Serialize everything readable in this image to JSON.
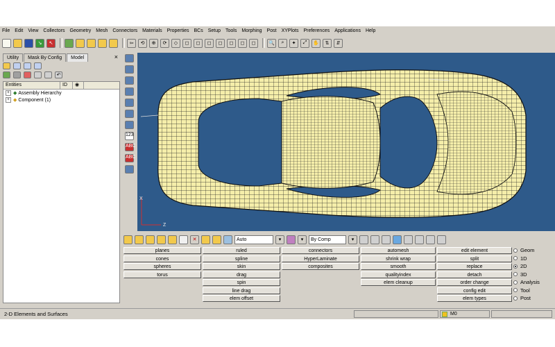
{
  "menu": [
    "File",
    "Edit",
    "View",
    "Collectors",
    "Geometry",
    "Mesh",
    "Connectors",
    "Materials",
    "Properties",
    "BCs",
    "Setup",
    "Tools",
    "Morphing",
    "Post",
    "XYPlots",
    "Preferences",
    "Applications",
    "Help"
  ],
  "panel": {
    "tabs": [
      "Utility",
      "Mask By Config",
      "Model"
    ],
    "active_tab": "Model",
    "columns": [
      "Entities",
      "ID"
    ],
    "tree": [
      {
        "label": "Assembly Hierarchy"
      },
      {
        "label": "Component (1)"
      }
    ]
  },
  "viewport": {
    "background": "#2e5a8a",
    "mesh_color": "#f5eeaa",
    "axes": {
      "x": "X",
      "z": "Z"
    }
  },
  "bottom_toolbar": {
    "dropdown_auto": "Auto",
    "dropdown_bycomp": "By Comp"
  },
  "buttons": {
    "col1": [
      "planes",
      "cones",
      "spheres",
      "torus"
    ],
    "col2": [
      "ruled",
      "spline",
      "skin",
      "drag",
      "spin",
      "line drag",
      "elem offset"
    ],
    "col3": [
      "connectors",
      "HyperLaminate",
      "composites"
    ],
    "col4": [
      "automesh",
      "shrink wrap",
      "smooth",
      "qualityindex",
      "elem cleanup"
    ],
    "col5": [
      "edit element",
      "split",
      "replace",
      "detach",
      "order change",
      "config edit",
      "elem types"
    ]
  },
  "radios": {
    "options": [
      "Geom",
      "1D",
      "2D",
      "3D",
      "Analysis",
      "Tool",
      "Post"
    ],
    "selected": "2D"
  },
  "status": {
    "text": "2-D Elements and Surfaces",
    "model": "M0"
  }
}
